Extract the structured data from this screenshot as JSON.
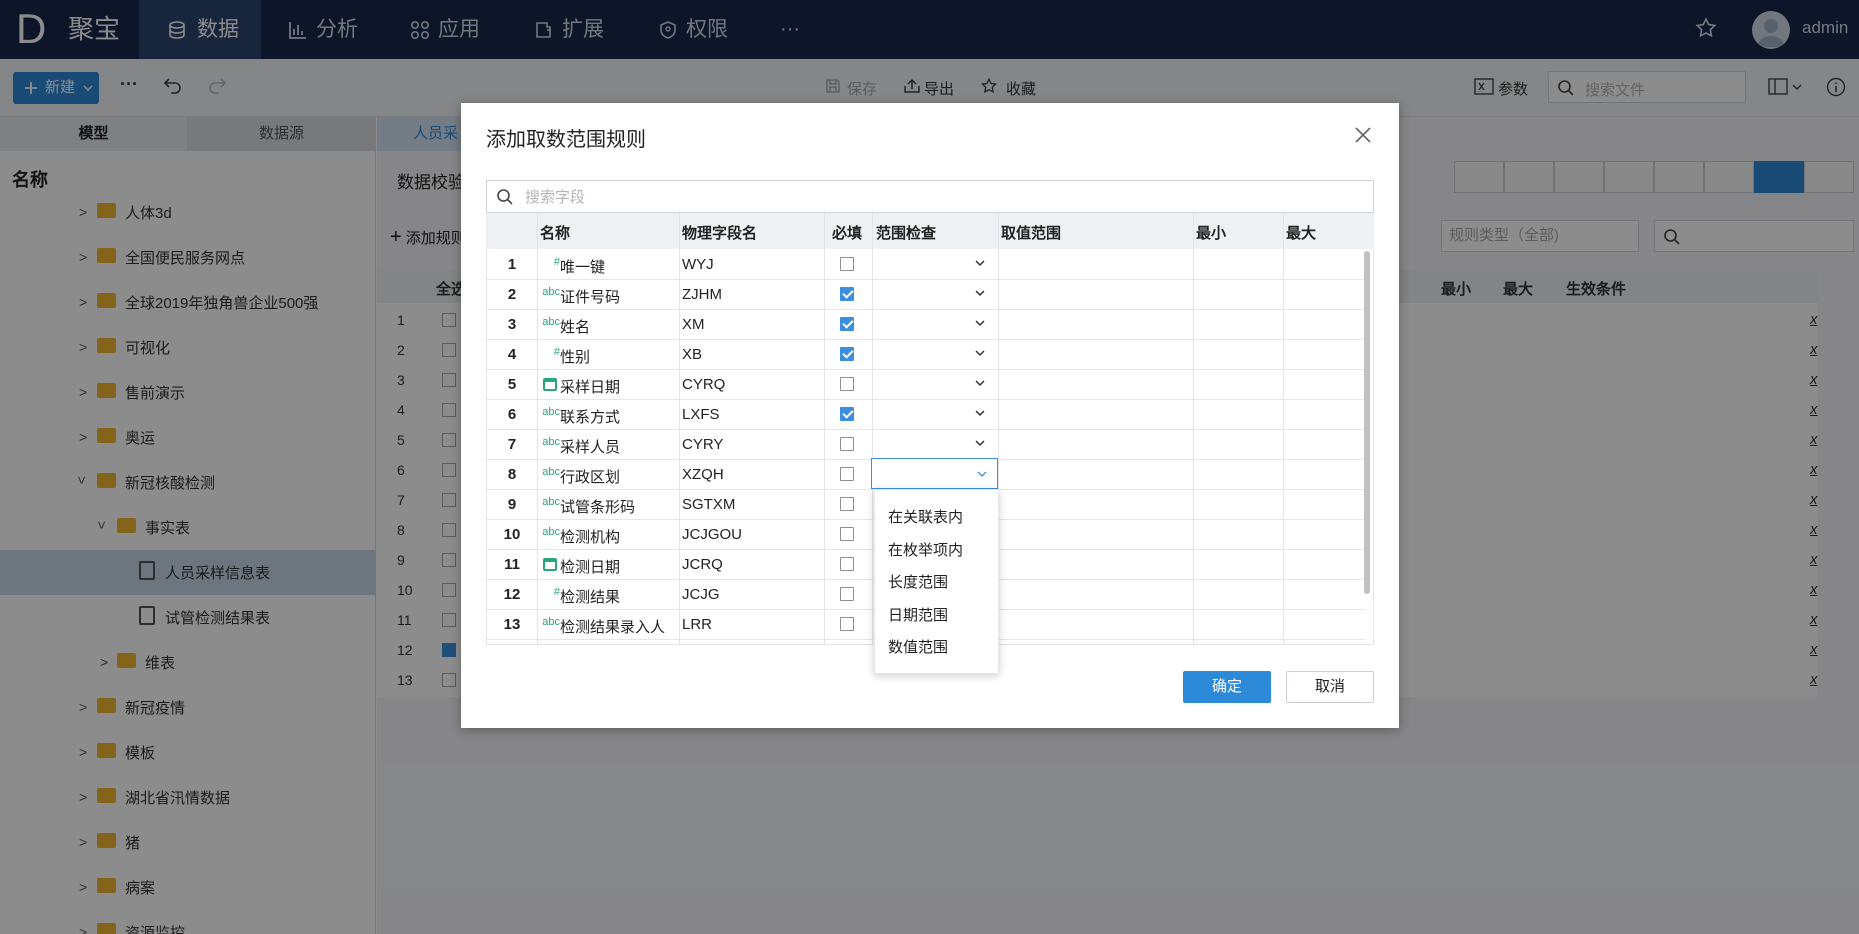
{
  "nav": {
    "logo_letter": "D",
    "app_name": "聚宝",
    "items": [
      {
        "label": "数据",
        "icon": "database-icon",
        "active": true
      },
      {
        "label": "分析",
        "icon": "bar-chart-icon",
        "active": false
      },
      {
        "label": "应用",
        "icon": "apps-icon",
        "active": false
      },
      {
        "label": "扩展",
        "icon": "extension-icon",
        "active": false
      },
      {
        "label": "权限",
        "icon": "shield-icon",
        "active": false
      }
    ],
    "more": "···",
    "user": "admin"
  },
  "toolbar": {
    "new_label": "新建",
    "save_label": "保存",
    "export_label": "导出",
    "favorite_label": "收藏",
    "params_label": "参数",
    "search_placeholder": "搜索文件"
  },
  "left": {
    "tab_model": "模型",
    "tab_datasource": "数据源",
    "column_header": "名称",
    "tree": [
      {
        "label": "人体3d",
        "type": "folder"
      },
      {
        "label": "全国便民服务网点",
        "type": "folder"
      },
      {
        "label": "全球2019年独角兽企业500强",
        "type": "folder"
      },
      {
        "label": "可视化",
        "type": "folder"
      },
      {
        "label": "售前演示",
        "type": "folder"
      },
      {
        "label": "奥运",
        "type": "folder"
      },
      {
        "label": "新冠核酸检测",
        "type": "folder-open"
      },
      {
        "label": "事实表",
        "type": "folder-open"
      },
      {
        "label": "人员采样信息表",
        "type": "doc"
      },
      {
        "label": "试管检测结果表",
        "type": "doc"
      },
      {
        "label": "维表",
        "type": "folder"
      },
      {
        "label": "新冠疫情",
        "type": "folder"
      },
      {
        "label": "模板",
        "type": "folder"
      },
      {
        "label": "湖北省汛情数据",
        "type": "folder"
      },
      {
        "label": "猪",
        "type": "folder"
      },
      {
        "label": "病案",
        "type": "folder"
      },
      {
        "label": "资源监控",
        "type": "folder"
      }
    ]
  },
  "right": {
    "tab_label": "人员采",
    "title": "数据校验",
    "add_rule": "添加规则",
    "select_all": "全选",
    "rule_type_placeholder": "规则类型（全部)",
    "col_min": "最小",
    "col_max": "最大",
    "col_condition": "生效条件",
    "rows": [
      "1",
      "2",
      "3",
      "4",
      "5",
      "6",
      "7",
      "8",
      "9",
      "10",
      "11",
      "12",
      "13"
    ]
  },
  "dialog": {
    "title": "添加取数范围规则",
    "search_placeholder": "搜索字段",
    "columns": {
      "name": "名称",
      "physical": "物理字段名",
      "required": "必填",
      "range_check": "范围检查",
      "value_range": "取值范围",
      "min": "最小",
      "max": "最大"
    },
    "rows": [
      {
        "n": "1",
        "icon": "#",
        "name": "唯一键",
        "physical": "WYJ",
        "required": false
      },
      {
        "n": "2",
        "icon": "abc",
        "name": "证件号码",
        "physical": "ZJHM",
        "required": true
      },
      {
        "n": "3",
        "icon": "abc",
        "name": "姓名",
        "physical": "XM",
        "required": true
      },
      {
        "n": "4",
        "icon": "#",
        "name": "性别",
        "physical": "XB",
        "required": true
      },
      {
        "n": "5",
        "icon": "date",
        "name": "采样日期",
        "physical": "CYRQ",
        "required": false
      },
      {
        "n": "6",
        "icon": "abc",
        "name": "联系方式",
        "physical": "LXFS",
        "required": true
      },
      {
        "n": "7",
        "icon": "abc",
        "name": "采样人员",
        "physical": "CYRY",
        "required": false
      },
      {
        "n": "8",
        "icon": "abc",
        "name": "行政区划",
        "physical": "XZQH",
        "required": false
      },
      {
        "n": "9",
        "icon": "abc",
        "name": "试管条形码",
        "physical": "SGTXM",
        "required": false
      },
      {
        "n": "10",
        "icon": "abc",
        "name": "检测机构",
        "physical": "JCJGOU",
        "required": false
      },
      {
        "n": "11",
        "icon": "date",
        "name": "检测日期",
        "physical": "JCRQ",
        "required": false
      },
      {
        "n": "12",
        "icon": "#",
        "name": "检测结果",
        "physical": "JCJG",
        "required": false
      },
      {
        "n": "13",
        "icon": "abc",
        "name": "检测结果录入人",
        "physical": "LRR",
        "required": false
      }
    ],
    "dropdown_options": [
      "在关联表内",
      "在枚举项内",
      "长度范围",
      "日期范围",
      "数值范围"
    ],
    "ok_label": "确定",
    "cancel_label": "取消"
  },
  "colors": {
    "nav_bg": "#17284a",
    "accent": "#2d8ad9",
    "field_icon": "#2aa77a",
    "folder": "#f0b431"
  }
}
